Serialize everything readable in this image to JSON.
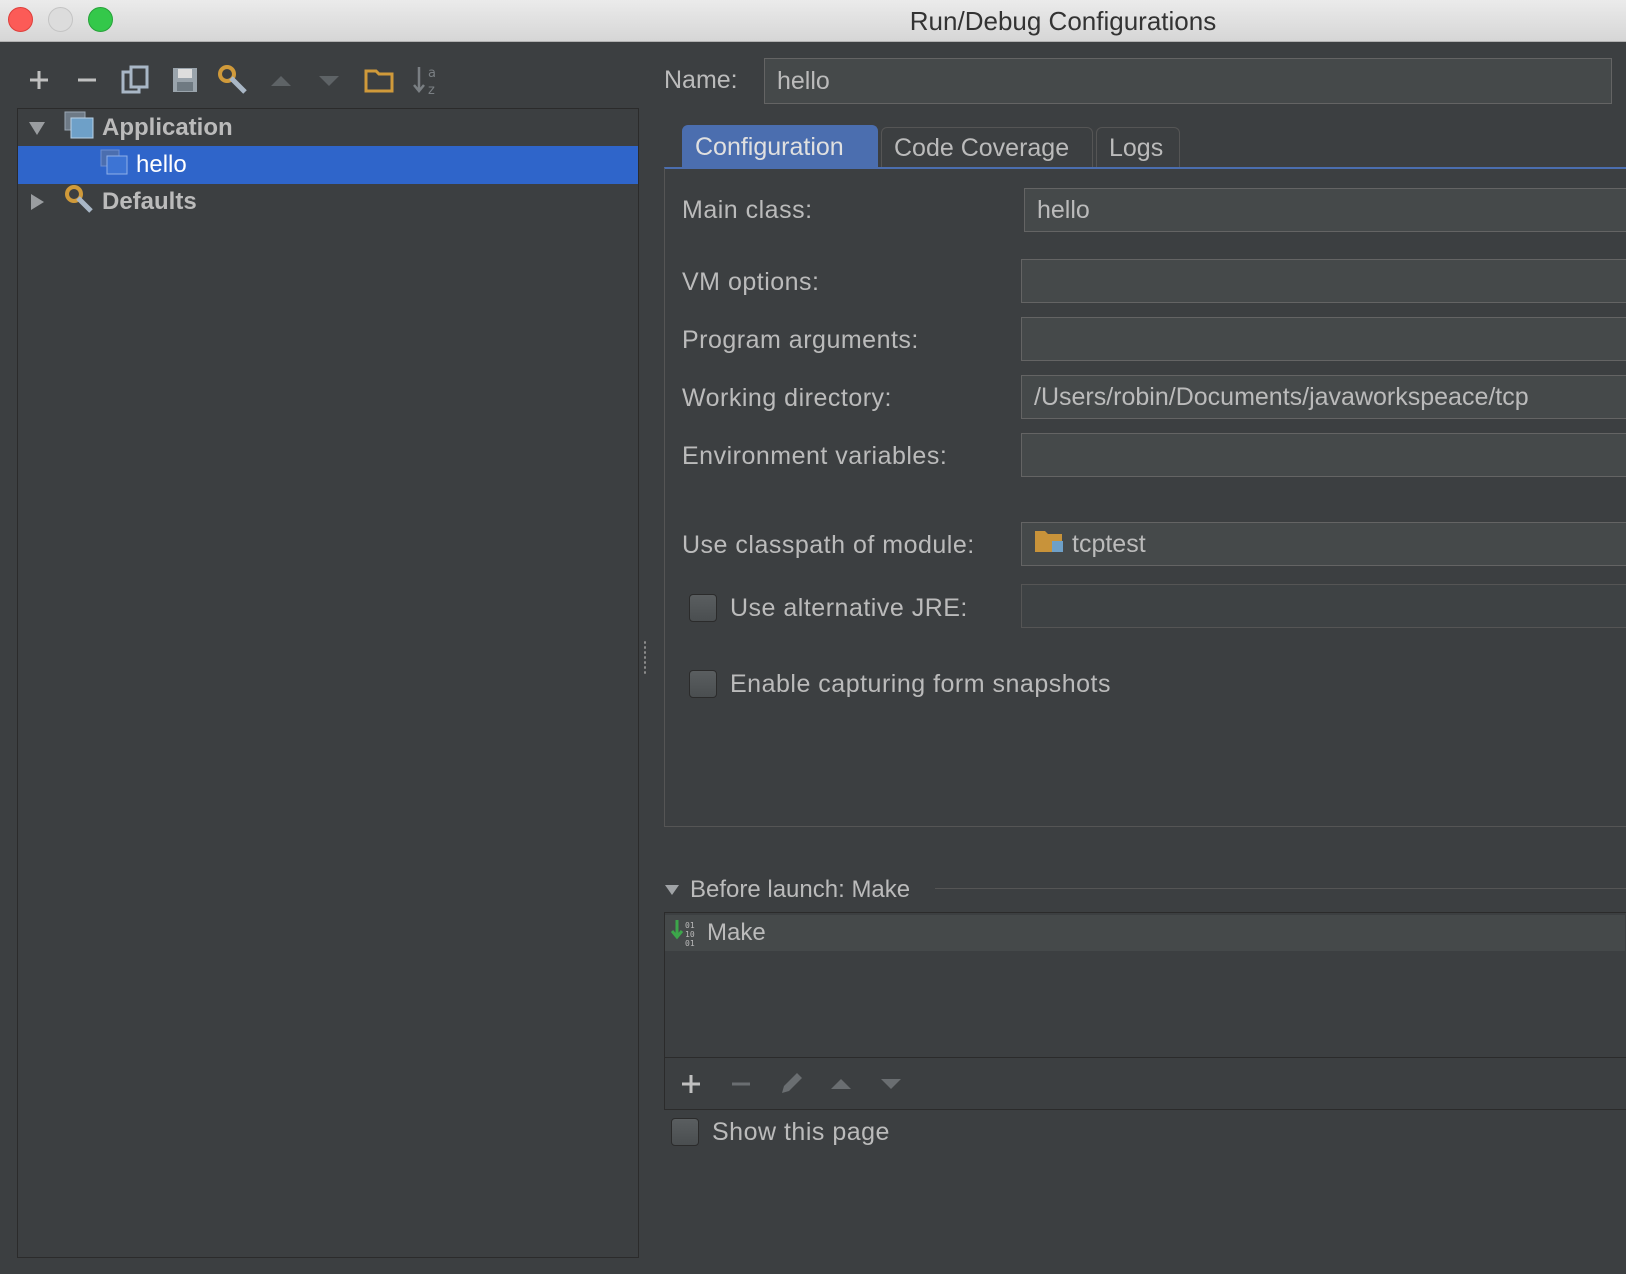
{
  "window": {
    "title": "Run/Debug Configurations"
  },
  "tree": {
    "items": [
      {
        "label": "Application",
        "expanded": true
      },
      {
        "label": "hello",
        "selected": true
      },
      {
        "label": "Defaults",
        "expanded": false
      }
    ]
  },
  "form": {
    "name_label": "Name:",
    "name_value": "hello",
    "tabs": [
      {
        "label": "Configuration",
        "active": true
      },
      {
        "label": "Code Coverage"
      },
      {
        "label": "Logs"
      }
    ],
    "main_class_label": "Main class:",
    "main_class_value": "hello",
    "vm_options_label": "VM options:",
    "vm_options_value": "",
    "program_args_label": "Program arguments:",
    "program_args_value": "",
    "working_dir_label": "Working directory:",
    "working_dir_value": "/Users/robin/Documents/javaworkspeace/tcp",
    "env_vars_label": "Environment variables:",
    "env_vars_value": "",
    "classpath_label": "Use classpath of module:",
    "classpath_value": "tcptest",
    "alt_jre_label": "Use alternative JRE:",
    "alt_jre_checked": false,
    "alt_jre_value": "",
    "snapshots_label": "Enable capturing form snapshots",
    "snapshots_checked": false
  },
  "before_launch": {
    "header": "Before launch: Make",
    "items": [
      "Make"
    ],
    "show_page_label": "Show this page",
    "show_page_checked": false
  },
  "colors": {
    "background": "#3c3f41",
    "selection": "#2f65ca",
    "active_tab": "#4b6eaf",
    "input_bg": "#45494a",
    "text": "#bbbbbb"
  }
}
